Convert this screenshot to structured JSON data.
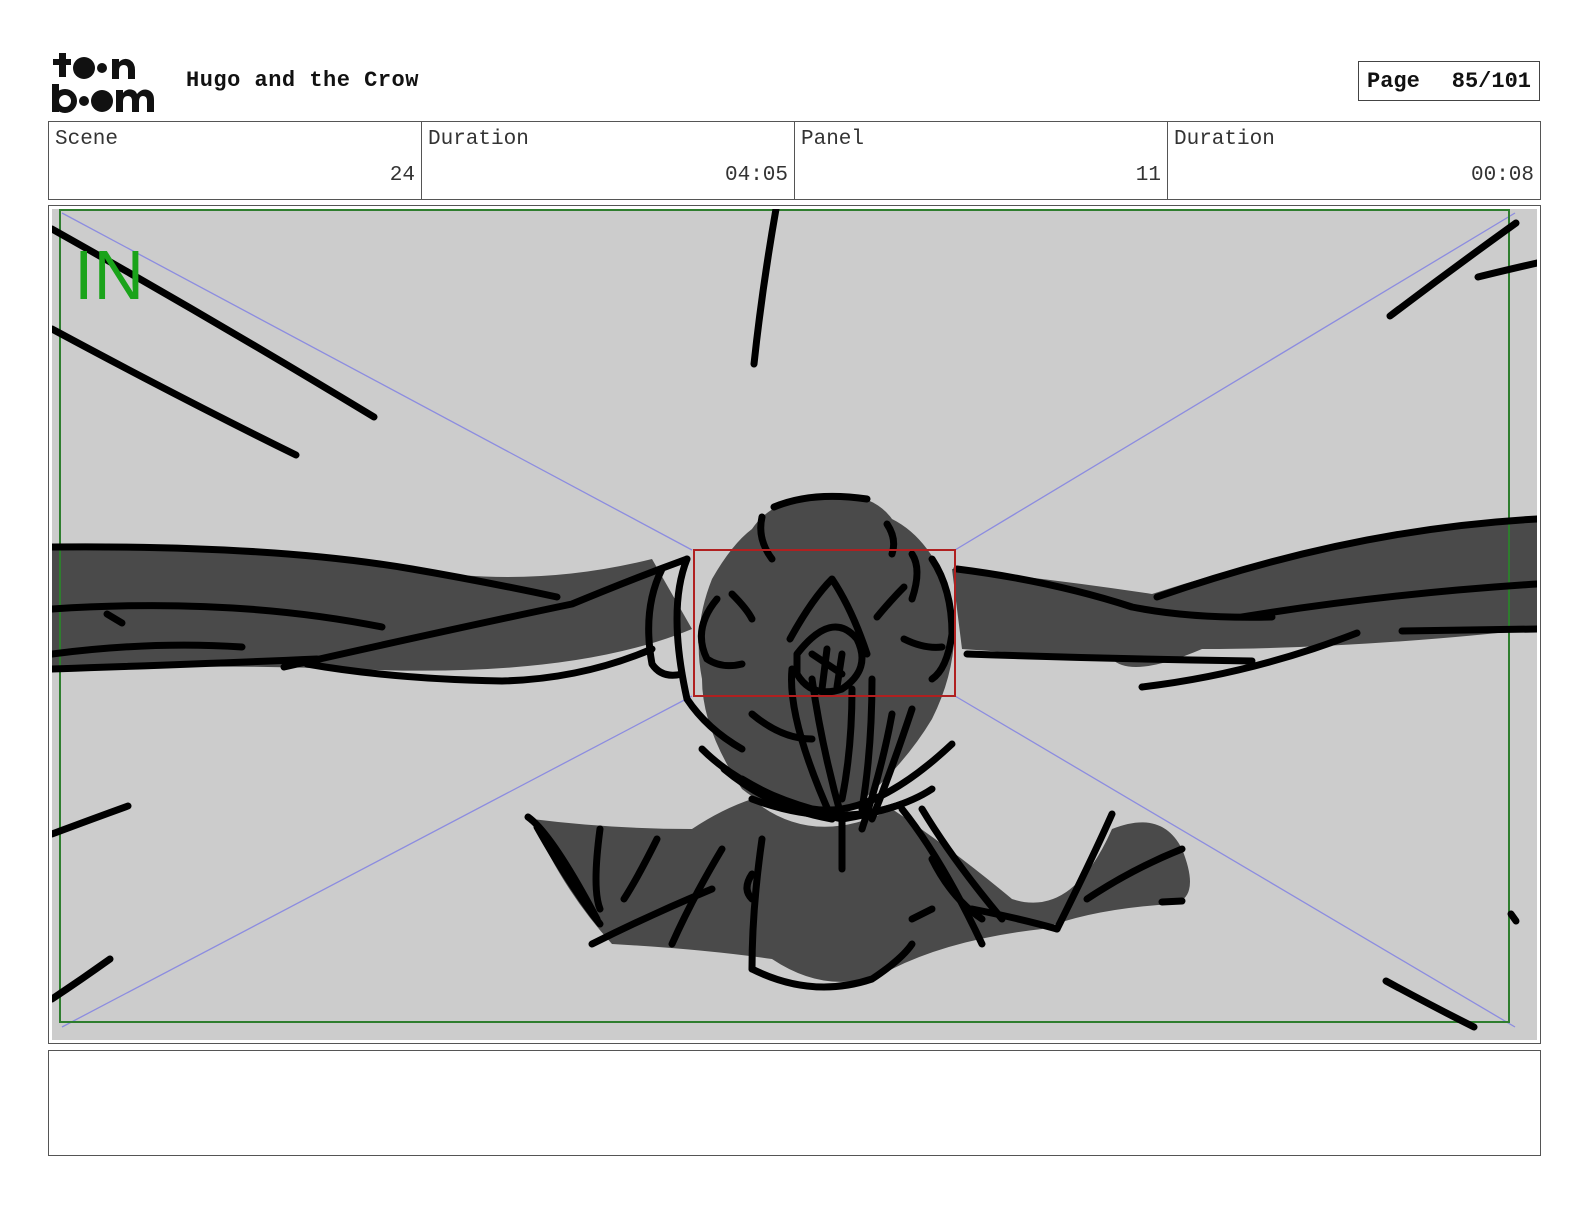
{
  "header": {
    "logo_text": "toon boom",
    "project_title": "Hugo and the Crow",
    "page_label": "Page",
    "page_value": "85/101"
  },
  "info": {
    "scene_label": "Scene",
    "scene_value": "24",
    "scene_duration_label": "Duration",
    "scene_duration_value": "04:05",
    "panel_label": "Panel",
    "panel_value": "11",
    "panel_duration_label": "Duration",
    "panel_duration_value": "00:08"
  },
  "panel": {
    "transition_marker": "IN"
  },
  "notes": {
    "text": ""
  },
  "colors": {
    "safe_frame": "#2e7d2e",
    "in_marker": "#1aa31a",
    "camera_box": "#b02020",
    "guide_lines": "#8c8ce0",
    "background_fill": "#cccccc",
    "figure_fill": "#4a4a4a"
  }
}
